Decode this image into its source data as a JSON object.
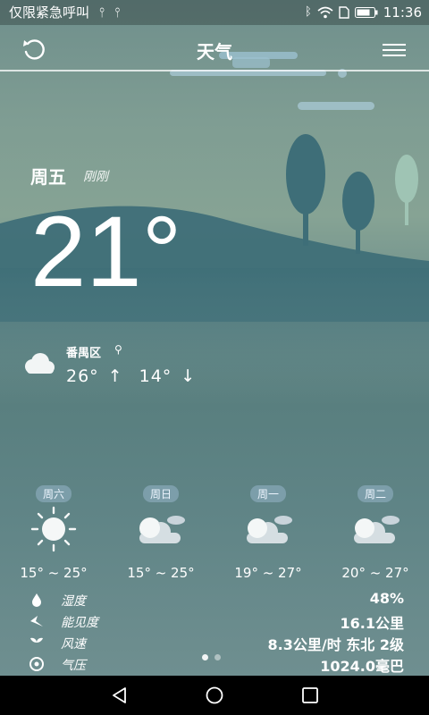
{
  "status_bar": {
    "left_text": "仅限紧急呼叫",
    "time": "11:36",
    "icons": [
      "usb-icon",
      "usb-icon",
      "bluetooth-icon",
      "wifi-icon",
      "sim-icon",
      "battery-icon"
    ]
  },
  "header": {
    "title": "天气",
    "refresh_icon": "refresh-icon",
    "menu_icon": "menu-icon"
  },
  "current": {
    "day": "周五",
    "updated": "刚刚",
    "temperature": "21°",
    "location": "番禺区",
    "high": "26°",
    "high_arrow": "↑",
    "low": "14°",
    "low_arrow": "↓",
    "condition_icon": "cloudy-icon"
  },
  "forecast": [
    {
      "day": "周六",
      "icon": "sunny-icon",
      "range": "15° ~ 25°"
    },
    {
      "day": "周日",
      "icon": "cloudy-icon",
      "range": "15° ~ 25°"
    },
    {
      "day": "周一",
      "icon": "cloudy-icon",
      "range": "19° ~ 27°"
    },
    {
      "day": "周二",
      "icon": "cloudy-icon",
      "range": "20° ~ 27°"
    }
  ],
  "details": [
    {
      "label": "湿度",
      "value": "48%",
      "icon": "humidity-icon"
    },
    {
      "label": "能见度",
      "value": "16.1公里",
      "icon": "visibility-icon"
    },
    {
      "label": "风速",
      "value": "8.3公里/时 东北 2级",
      "icon": "wind-icon"
    },
    {
      "label": "气压",
      "value": "1024.0毫巴",
      "icon": "pressure-icon"
    }
  ],
  "pager": {
    "pages": 2,
    "current": 1
  },
  "colors": {
    "accent": "#ffffff",
    "hill": "#3f6f78",
    "tree": "#3e6e78",
    "tree_light": "#9fc4b4"
  }
}
